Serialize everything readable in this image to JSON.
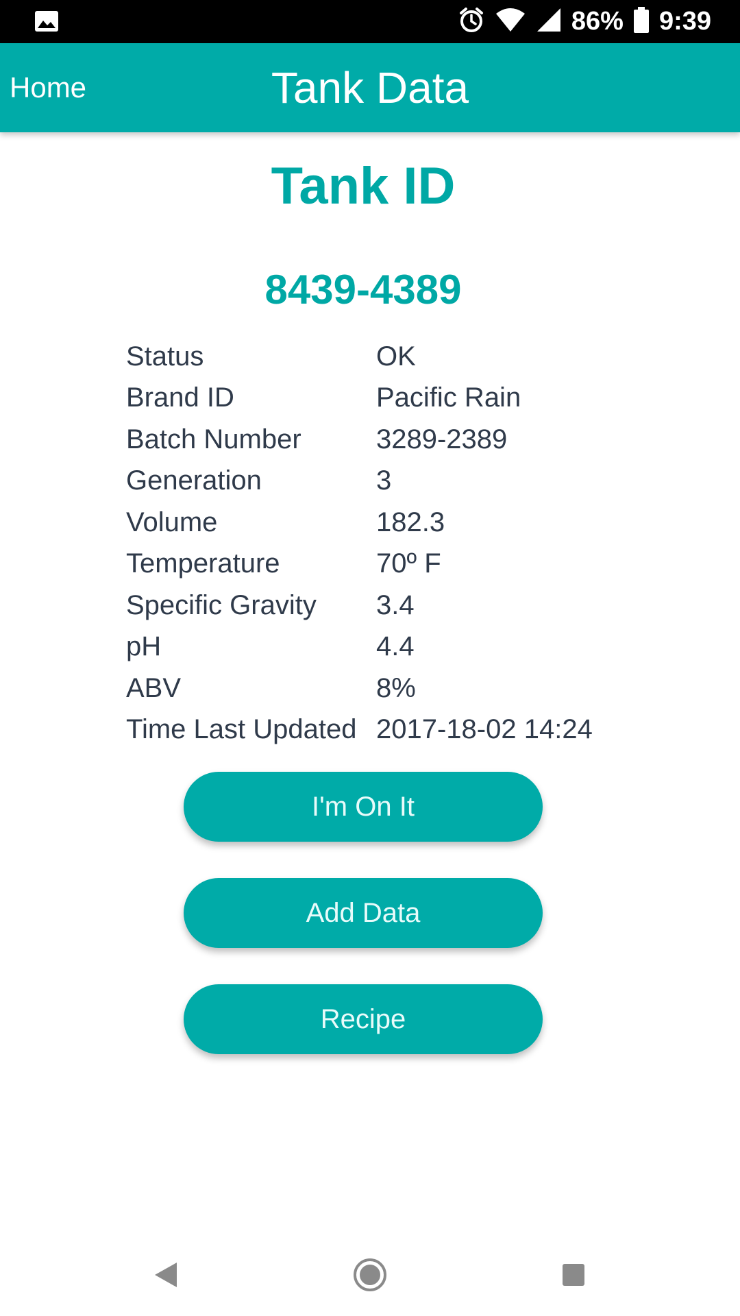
{
  "status_bar": {
    "battery": "86%",
    "time": "9:39",
    "icons": [
      "image-icon",
      "alarm-icon",
      "wifi-icon",
      "signal-icon",
      "battery-icon"
    ]
  },
  "app_bar": {
    "home_label": "Home",
    "title": "Tank Data"
  },
  "tank": {
    "heading": "Tank ID",
    "id": "8439-4389",
    "details": [
      {
        "label": "Status",
        "value": "OK"
      },
      {
        "label": "Brand ID",
        "value": "Pacific Rain"
      },
      {
        "label": "Batch Number",
        "value": "3289-2389"
      },
      {
        "label": "Generation",
        "value": "3"
      },
      {
        "label": "Volume",
        "value": "182.3"
      },
      {
        "label": "Temperature",
        "value": "70º F"
      },
      {
        "label": "Specific Gravity",
        "value": "3.4"
      },
      {
        "label": "pH",
        "value": "4.4"
      },
      {
        "label": "ABV",
        "value": "8%"
      },
      {
        "label": "Time Last Updated",
        "value": "2017-18-02 14:24"
      }
    ]
  },
  "actions": {
    "on_it": "I'm On It",
    "add_data": "Add Data",
    "recipe": "Recipe"
  },
  "colors": {
    "accent": "#00ABA8",
    "text": "#2f3a4a"
  },
  "nav_bar": {
    "icons": [
      "back-icon",
      "home-icon",
      "recents-icon"
    ]
  }
}
